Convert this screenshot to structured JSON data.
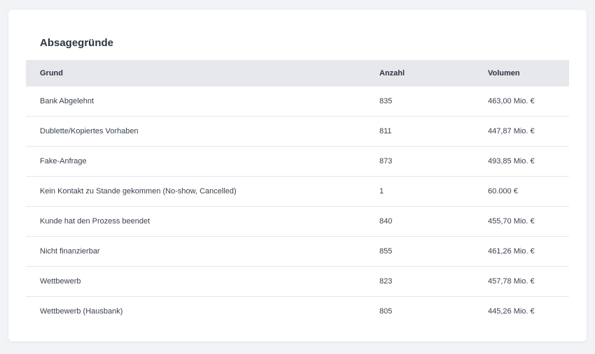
{
  "card": {
    "title": "Absagegründe"
  },
  "table": {
    "columns": [
      "Grund",
      "Anzahl",
      "Volumen"
    ],
    "rows": [
      {
        "reason": "Bank Abgelehnt",
        "count": "835",
        "volume": "463,00 Mio. €"
      },
      {
        "reason": "Dublette/Kopiertes Vorhaben",
        "count": "811",
        "volume": "447,87 Mio. €"
      },
      {
        "reason": "Fake-Anfrage",
        "count": "873",
        "volume": "493,85 Mio. €"
      },
      {
        "reason": "Kein Kontakt zu Stande gekommen (No-show, Cancelled)",
        "count": "1",
        "volume": "60.000 €"
      },
      {
        "reason": "Kunde hat den Prozess beendet",
        "count": "840",
        "volume": "455,70 Mio. €"
      },
      {
        "reason": "Nicht finanzierbar",
        "count": "855",
        "volume": "461,26 Mio. €"
      },
      {
        "reason": "Wettbewerb",
        "count": "823",
        "volume": "457,78 Mio. €"
      },
      {
        "reason": "Wettbewerb (Hausbank)",
        "count": "805",
        "volume": "445,26 Mio. €"
      }
    ]
  },
  "colors": {
    "page_background": "#f1f3f7",
    "card_background": "#ffffff",
    "header_background": "#e6e8ec",
    "text": "#2c3442",
    "divider": "#e4e6ea"
  }
}
